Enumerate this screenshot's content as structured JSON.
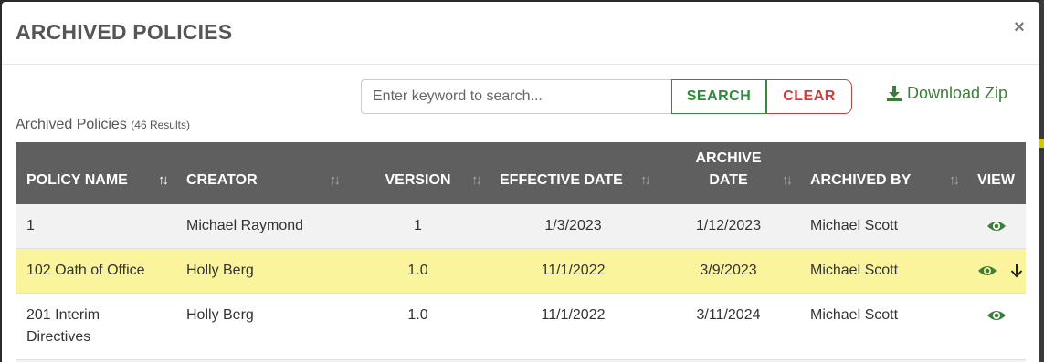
{
  "modal": {
    "title": "ARCHIVED POLICIES",
    "close_label": "×"
  },
  "search": {
    "placeholder": "Enter keyword to search...",
    "value": "",
    "search_label": "SEARCH",
    "clear_label": "CLEAR"
  },
  "download": {
    "label": "Download Zip",
    "icon": "download-icon"
  },
  "results": {
    "label": "Archived Policies",
    "count": "(46 Results)"
  },
  "table": {
    "columns": [
      "POLICY NAME",
      "CREATOR",
      "VERSION",
      "EFFECTIVE DATE",
      "ARCHIVE DATE",
      "ARCHIVED BY",
      "VIEW"
    ],
    "rows": [
      {
        "name": "1",
        "creator": "Michael Raymond",
        "version": "1",
        "effective": "1/3/2023",
        "archive": "1/12/2023",
        "archived_by": "Michael Scott"
      },
      {
        "name": "102 Oath of Office",
        "creator": "Holly Berg",
        "version": "1.0",
        "effective": "11/1/2022",
        "archive": "3/9/2023",
        "archived_by": "Michael Scott"
      },
      {
        "name": "201 Interim Directives",
        "creator": "Holly Berg",
        "version": "1.0",
        "effective": "11/1/2022",
        "archive": "3/11/2024",
        "archived_by": "Michael Scott"
      }
    ]
  },
  "colors": {
    "header_bg": "#5f5f5f",
    "highlight_row": "#faf59c",
    "search_green": "#2e8b3c",
    "clear_red": "#d43c3c",
    "eye_green": "#3d7d3a"
  }
}
